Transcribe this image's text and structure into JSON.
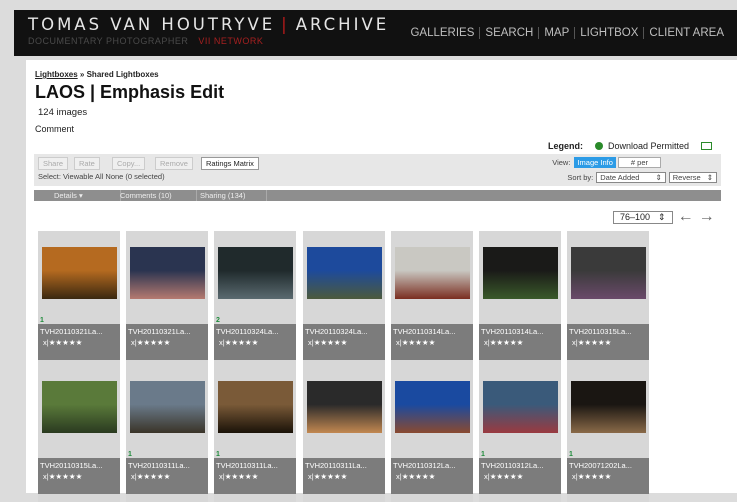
{
  "header": {
    "brand_left": "TOMAS VAN HOUTRYVE",
    "brand_sep": "|",
    "brand_right": "ARCHIVE",
    "tagline": "DOCUMENTARY PHOTOGRAPHER",
    "network": "VII NETWORK",
    "nav": [
      "GALLERIES",
      "SEARCH",
      "MAP",
      "LIGHTBOX",
      "CLIENT AREA"
    ]
  },
  "breadcrumb": {
    "link": "Lightboxes",
    "sep": "»",
    "current": "Shared Lightboxes"
  },
  "page": {
    "title": "LAOS | Emphasis Edit",
    "image_count": "124 images",
    "comment_label": "Comment"
  },
  "legend": {
    "label": "Legend:",
    "download": "Download Permitted"
  },
  "toolbar": {
    "buttons": [
      "Share",
      "Rate",
      "Copy...",
      "Remove",
      "Ratings Matrix"
    ],
    "select_line": "Select:  Viewable  All  None  (0 selected)",
    "view_label": "View:",
    "view_active": "Image Info",
    "per_label": "# per",
    "sort_label": "Sort by:",
    "sort_value": "Date Added",
    "order_value": "Reverse"
  },
  "tabs": [
    "Details ▾",
    "Comments (10)",
    "Sharing (134)"
  ],
  "pager": {
    "range": "76–100",
    "prev": "←",
    "next": "→"
  },
  "thumbs": [
    {
      "name": "TVH20110321La...",
      "flag": "1",
      "rating": "x|★★★★★",
      "colors": [
        "#b56a20",
        "#3a2810"
      ]
    },
    {
      "name": "TVH20110321La...",
      "flag": "",
      "rating": "x|★★★★★",
      "colors": [
        "#2a3450",
        "#b57a70"
      ]
    },
    {
      "name": "TVH20110324La...",
      "flag": "2",
      "rating": "x|★★★★★",
      "colors": [
        "#202a2c",
        "#5a6a70"
      ]
    },
    {
      "name": "TVH20110324La...",
      "flag": "",
      "rating": "x|★★★★★",
      "colors": [
        "#1d4a9c",
        "#4c5a3c"
      ]
    },
    {
      "name": "TVH20110314La...",
      "flag": "",
      "rating": "x|★★★★★",
      "colors": [
        "#c9c8c2",
        "#7a2e20"
      ]
    },
    {
      "name": "TVH20110314La...",
      "flag": "",
      "rating": "x|★★★★★",
      "colors": [
        "#1a1a18",
        "#3a5a2a"
      ]
    },
    {
      "name": "TVH20110315La...",
      "flag": "",
      "rating": "x|★★★★★",
      "colors": [
        "#3a3a3a",
        "#6a4a6a"
      ]
    },
    {
      "name": "TVH20110315La...",
      "flag": "",
      "rating": "x|★★★★★",
      "colors": [
        "#5a7a3a",
        "#2a3a20"
      ]
    },
    {
      "name": "TVH20110311La...",
      "flag": "1",
      "rating": "x|★★★★★",
      "colors": [
        "#6a7a8a",
        "#3a3428"
      ]
    },
    {
      "name": "TVH20110311La...",
      "flag": "1",
      "rating": "x|★★★★★",
      "colors": [
        "#7a5a38",
        "#1a1208"
      ]
    },
    {
      "name": "TVH20110311La...",
      "flag": "",
      "rating": "x|★★★★★",
      "colors": [
        "#2a2a2a",
        "#c28850"
      ]
    },
    {
      "name": "TVH20110312La...",
      "flag": "",
      "rating": "x|★★★★★",
      "colors": [
        "#1a4aa0",
        "#8a4a30"
      ]
    },
    {
      "name": "TVH20110312La...",
      "flag": "1",
      "rating": "x|★★★★★",
      "colors": [
        "#3a5a7a",
        "#9a3a40"
      ]
    },
    {
      "name": "TVH20071202La...",
      "flag": "1",
      "rating": "x|★★★★★",
      "colors": [
        "#1a1612",
        "#8a6a48"
      ]
    }
  ]
}
